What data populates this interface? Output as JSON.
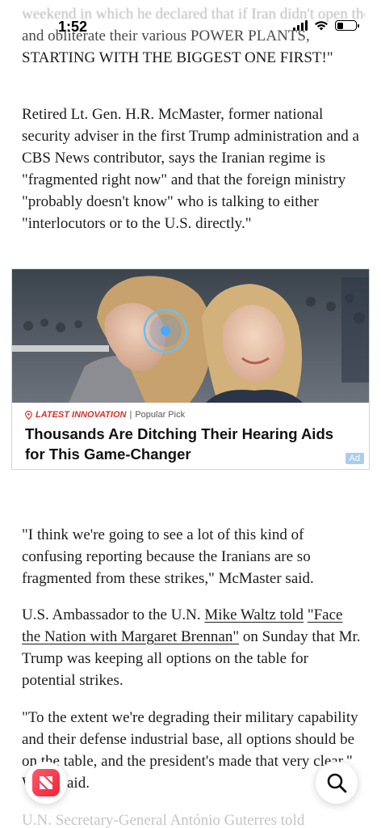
{
  "status_bar": {
    "time": "1:52"
  },
  "article": {
    "top_paragraph_faded": "weekend in which he declared that if Iran didn't open the Strait of Hormuz, the U.S. would",
    "top_paragraph_line2": "and obliterate their various POWER PLANTS,",
    "top_paragraph_line3": "STARTING WITH THE BIGGEST ONE FIRST!\"",
    "p1": "Retired Lt. Gen. H.R. McMaster, former national security adviser in the first Trump administra­tion and a CBS News contributor, says the Iran­ian regime is \"fragmented right now\" and that the foreign ministry \"probably doesn't know\" who is talking to either \"interlocutors or to the U.S. directly.\"",
    "p2": "\"I think we're going to see a lot of this kind of confusing reporting because the Iranians are so fragmented from these strikes,\" McMaster said.",
    "p3_prefix": "U.S. Ambassador to the U.N. ",
    "p3_link1": "Mike Waltz told",
    "p3_space": " ",
    "p3_link2": "\"Face the Nation with Margaret Brennan\"",
    "p3_suffix": " on Sunday that Mr. Trump was keeping all options on the table for potential strikes.",
    "p4": "\"To the extent we're degrading their military capability and their defense industrial base, all options should be on the table, and the presi­dent's made that very clear,\" Waltz said.",
    "p5": "U.N. Secretary-General António Guterres told"
  },
  "ad": {
    "tag": "LATEST INNOVATION",
    "separator": "|",
    "category": "Popular Pick",
    "title": "Thousands Are Ditching Their Hearing Aids for This Game-Changer",
    "badge": "Ad"
  },
  "buttons": {
    "news_icon": "apple-news-icon",
    "search_icon": "search-icon"
  },
  "colors": {
    "ad_tag": "#d6322b",
    "ad_badge": "#aacdee",
    "news_brand": "#f0213a"
  }
}
